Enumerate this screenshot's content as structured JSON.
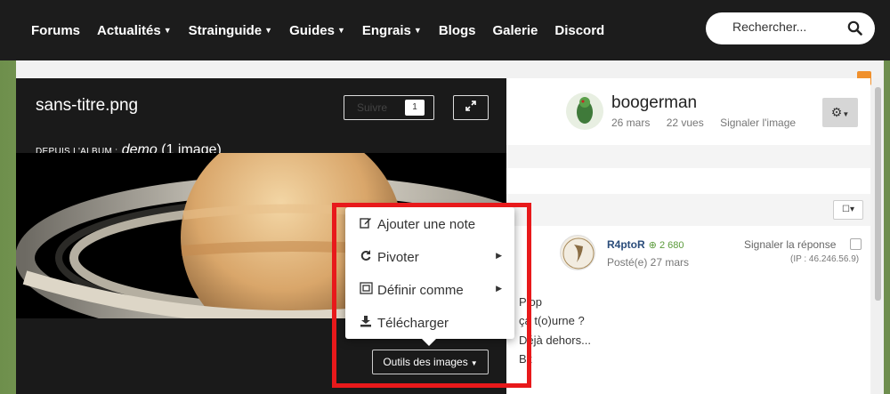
{
  "nav": {
    "items": [
      {
        "label": "Forums",
        "dropdown": false
      },
      {
        "label": "Actualités",
        "dropdown": true
      },
      {
        "label": "Strainguide",
        "dropdown": true
      },
      {
        "label": "Guides",
        "dropdown": true
      },
      {
        "label": "Engrais",
        "dropdown": true
      },
      {
        "label": "Blogs",
        "dropdown": false
      },
      {
        "label": "Galerie",
        "dropdown": false
      },
      {
        "label": "Discord",
        "dropdown": false
      }
    ],
    "search_placeholder": "Rechercher..."
  },
  "viewer": {
    "title": "sans-titre.png",
    "follow_label": "Suivre",
    "follow_count": "1",
    "album_prefix": "DEPUIS L'ALBUM :",
    "album_name": "demo",
    "album_count": "(1 image)",
    "tools_label": "Outils des images"
  },
  "menu": {
    "items": [
      {
        "icon": "edit-icon",
        "label": "Ajouter une note",
        "submenu": false
      },
      {
        "icon": "rotate-icon",
        "label": "Pivoter",
        "submenu": true
      },
      {
        "icon": "crop-icon",
        "label": "Définir comme",
        "submenu": true
      },
      {
        "icon": "download-icon",
        "label": "Télécharger",
        "submenu": false
      }
    ]
  },
  "author": {
    "name": "boogerman",
    "date": "26 mars",
    "views": "22 vues",
    "report": "Signaler l'image"
  },
  "reply": {
    "name": "R4ptoR",
    "rep": "2 680",
    "date": "Posté(e) 27 mars",
    "report": "Signaler la réponse",
    "ip": "(IP : 46.246.56.9)",
    "lines": [
      "Plop",
      "ça t(o)urne ?",
      "Déjà dehors...",
      "Bz"
    ]
  },
  "colors": {
    "nav_bg": "#1c1c1c",
    "highlight": "#e8191b",
    "rep_green": "#5a9a3a",
    "link_blue": "#2a4c7a"
  }
}
